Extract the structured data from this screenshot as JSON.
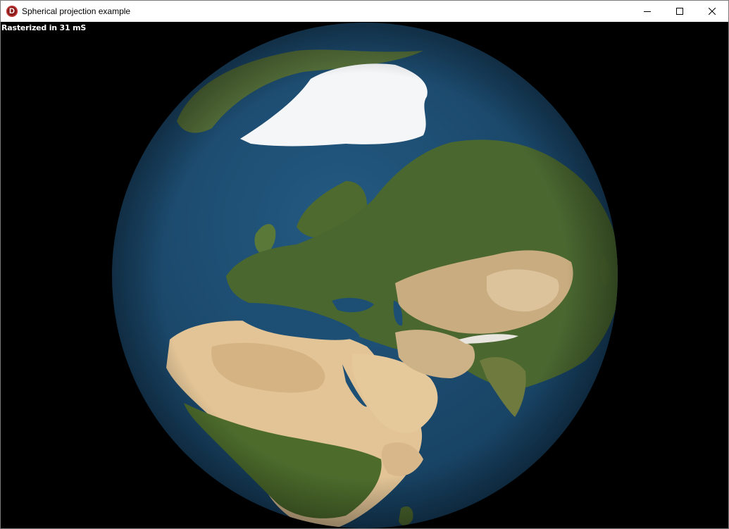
{
  "window": {
    "title": "Spherical projection example",
    "icon": "d-logo-icon",
    "controls": [
      "minimize-icon",
      "maximize-icon",
      "close-icon"
    ]
  },
  "status": {
    "text": "Rasterized in 31 mS"
  },
  "globe": {
    "ocean_color": "#1d4f74",
    "land_green": "#4d6b2e",
    "desert_color": "#e3c69a",
    "ice_color": "#ffffff"
  }
}
